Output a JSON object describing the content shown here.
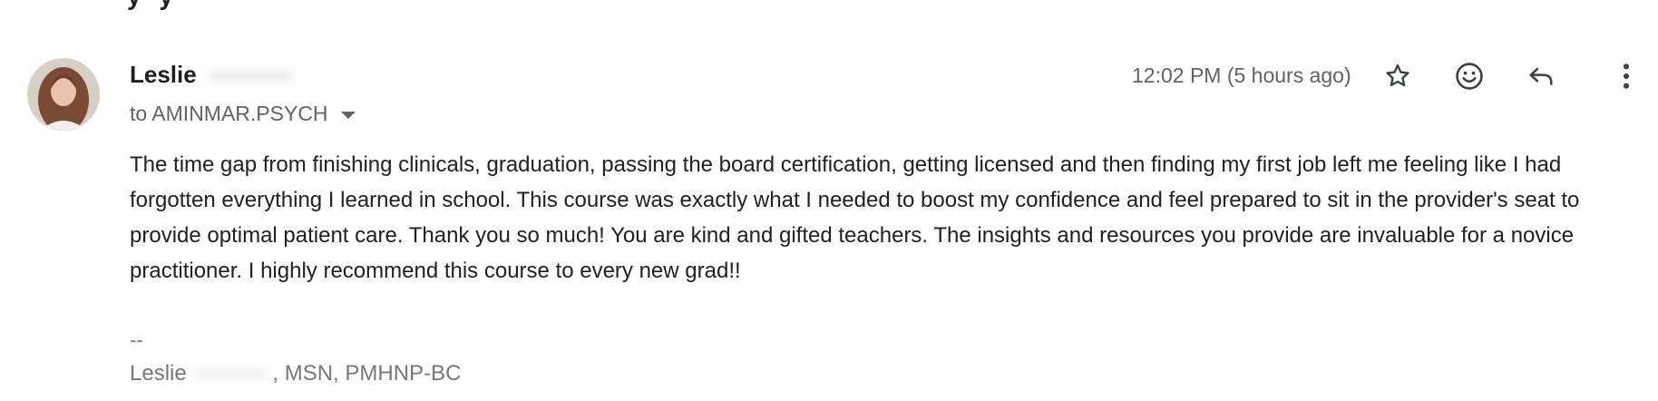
{
  "email": {
    "sender_name": "Leslie",
    "recipient_label": "to AMINMAR.PSYCH",
    "timestamp": "12:02 PM (5 hours ago)",
    "body": "The time gap from finishing clinicals, graduation, passing the board certification, getting licensed and then finding my first job left me feeling like I had forgotten everything I learned in school.  This course was exactly what I needed to boost my confidence and feel prepared to sit in the provider's seat to provide optimal patient care.  Thank you so much!  You are kind and gifted teachers.  The insights and resources you provide are invaluable for a novice practitioner.  I highly recommend this course to every new grad!!",
    "signature": {
      "separator": "--",
      "first_name": "Leslie",
      "credentials": ", MSN, PMHNP-BC"
    }
  },
  "actions": {
    "star": "star-icon",
    "react": "emoji-icon",
    "reply": "reply-icon",
    "more": "more-vert-icon"
  },
  "colors": {
    "primary_text": "#1f1f1f",
    "secondary_text": "#5f6368",
    "signature_text": "#777777"
  }
}
